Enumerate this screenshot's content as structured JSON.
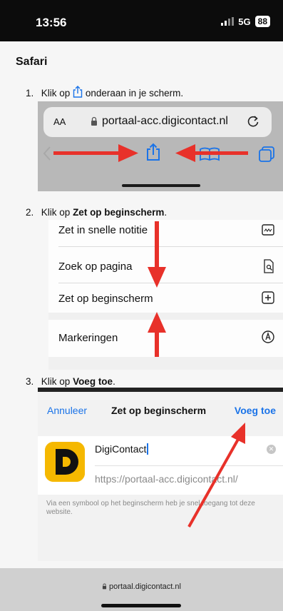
{
  "status": {
    "time": "13:56",
    "network": "5G",
    "battery": "88"
  },
  "heading": "Safari",
  "steps": [
    {
      "num": "1.",
      "pre": "Klik op",
      "post": "onderaan in je scherm."
    },
    {
      "num": "2.",
      "pre": "Klik op",
      "bold": "Zet op beginscherm",
      "post": "."
    },
    {
      "num": "3.",
      "pre": "Klik op",
      "bold": "Voeg toe",
      "post": "."
    }
  ],
  "shot1": {
    "aa": "AA",
    "url": "portaal-acc.digicontact.nl"
  },
  "shot2": {
    "items": [
      "Zet in snelle notitie",
      "Zoek op pagina",
      "Zet op beginscherm",
      "Markeringen"
    ]
  },
  "shot3": {
    "cancel": "Annuleer",
    "title": "Zet op beginscherm",
    "add": "Voeg toe",
    "app_letter": "D",
    "app_name": "DigiContact",
    "app_url": "https://portaal-acc.digicontact.nl/",
    "hint": "Via een symbool op het beginscherm heb je snel toegang tot deze website."
  },
  "bottom_url": "portaal.digicontact.nl",
  "colors": {
    "accent": "#1a73e8",
    "arrow": "#e8312a",
    "brand": "#f5b800"
  }
}
